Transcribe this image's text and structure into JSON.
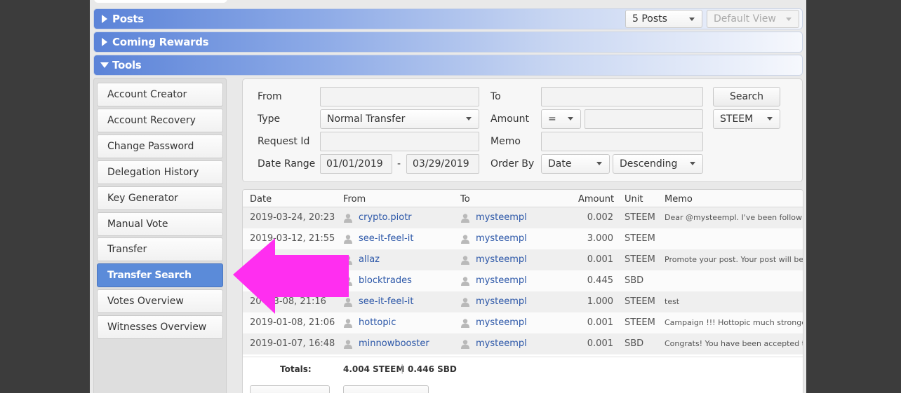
{
  "sections": {
    "posts": {
      "title": "Posts",
      "count_select": "5 Posts",
      "view_select": "Default View"
    },
    "coming_rewards": {
      "title": "Coming Rewards"
    },
    "tools": {
      "title": "Tools"
    }
  },
  "sidebar": {
    "items": [
      {
        "label": "Account Creator"
      },
      {
        "label": "Account Recovery"
      },
      {
        "label": "Change Password"
      },
      {
        "label": "Delegation History"
      },
      {
        "label": "Key Generator"
      },
      {
        "label": "Manual Vote"
      },
      {
        "label": "Transfer"
      },
      {
        "label": "Transfer Search",
        "active": true
      },
      {
        "label": "Votes Overview"
      },
      {
        "label": "Witnesses Overview"
      }
    ]
  },
  "form": {
    "from_label": "From",
    "from_value": "",
    "to_label": "To",
    "to_value": "",
    "search_button": "Search",
    "type_label": "Type",
    "type_value": "Normal Transfer",
    "amount_label": "Amount",
    "amount_op": "=",
    "amount_value": "",
    "currency": "STEEM",
    "request_id_label": "Request Id",
    "request_id_value": "",
    "memo_label": "Memo",
    "memo_value": "",
    "date_range_label": "Date Range",
    "date_from": "01/01/2019",
    "date_sep": "-",
    "date_to": "03/29/2019",
    "order_by_label": "Order By",
    "order_by_value": "Date",
    "order_dir": "Descending"
  },
  "table": {
    "headers": {
      "date": "Date",
      "from": "From",
      "to": "To",
      "amount": "Amount",
      "unit": "Unit",
      "memo": "Memo"
    },
    "rows": [
      {
        "date": "2019-03-24, 20:23",
        "from": "crypto.piotr",
        "to": "mysteempl",
        "amount": "0.002",
        "unit": "STEEM",
        "memo": "Dear @mysteempl. I've been following y"
      },
      {
        "date": "2019-03-12, 21:55",
        "from": "see-it-feel-it",
        "to": "mysteempl",
        "amount": "3.000",
        "unit": "STEEM",
        "memo": ""
      },
      {
        "date": "",
        "from": "allaz",
        "to": "mysteempl",
        "amount": "0.001",
        "unit": "STEEM",
        "memo": "Promote your post. Your post will be m"
      },
      {
        "date": "",
        "from": "blocktrades",
        "to": "mysteempl",
        "amount": "0.445",
        "unit": "SBD",
        "memo": ""
      },
      {
        "date": "20 -03-08, 21:16",
        "from": "see-it-feel-it",
        "to": "mysteempl",
        "amount": "1.000",
        "unit": "STEEM",
        "memo": "test"
      },
      {
        "date": "2019-01-08, 21:06",
        "from": "hottopic",
        "to": "mysteempl",
        "amount": "0.001",
        "unit": "STEEM",
        "memo": "Campaign !!! Hottopic much stronger no"
      },
      {
        "date": "2019-01-07, 16:48",
        "from": "minnowbooster",
        "to": "mysteempl",
        "amount": "0.001",
        "unit": "SBD",
        "memo": "Congrats! You have been accepted to th"
      }
    ],
    "totals_label": "Totals:",
    "totals_steem": "4.004 STEEM",
    "totals_sep": "|",
    "totals_sbd": "0.446 SBD"
  },
  "colors": {
    "accent": "#5b8bd9",
    "link": "#2c57a8",
    "annotation_arrow": "#ff2ef0"
  }
}
